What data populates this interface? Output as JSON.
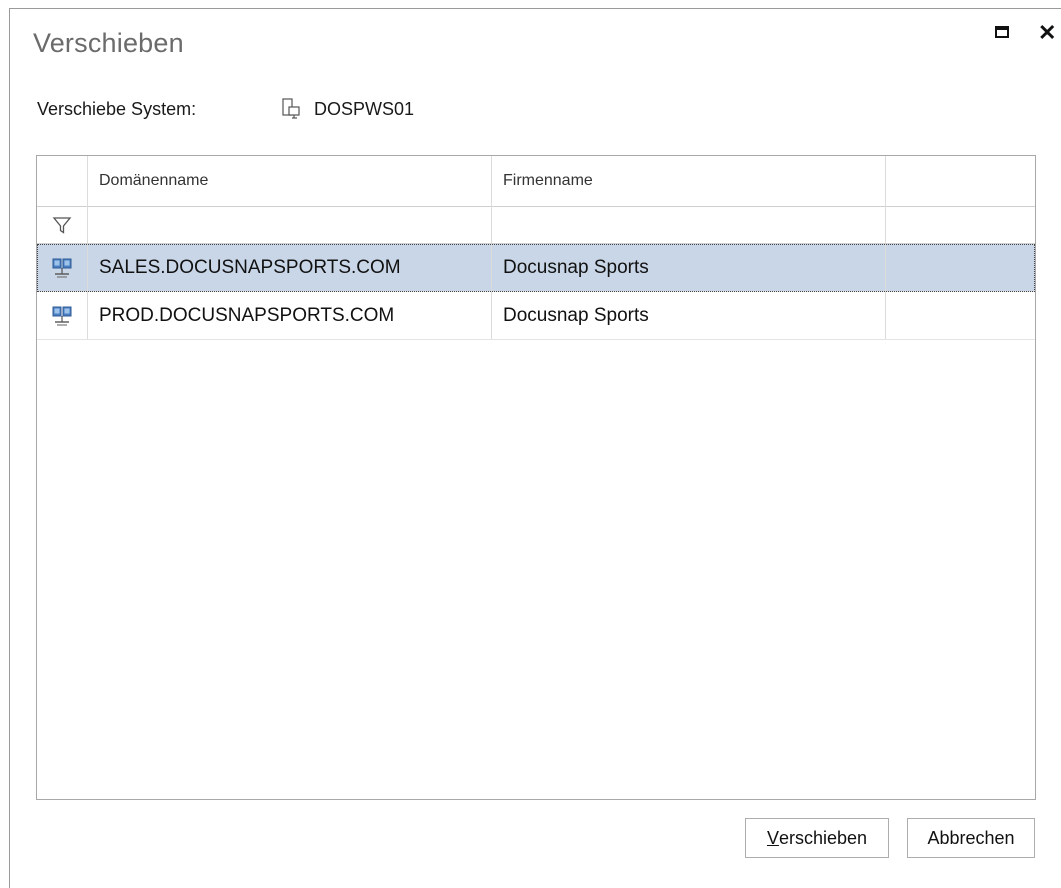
{
  "dialog": {
    "title": "Verschieben",
    "maximize_icon": "maximize-icon",
    "close_icon": "close-icon",
    "close_glyph": "✕"
  },
  "system": {
    "label": "Verschiebe System:",
    "icon": "computer-icon",
    "name": "DOSPWS01"
  },
  "grid": {
    "columns": [
      "Domänenname",
      "Firmenname"
    ],
    "filter_icon": "filter-icon",
    "rows": [
      {
        "icon": "domain-icon",
        "domain": "SALES.DOCUSNAPSPORTS.COM",
        "company": "Docusnap Sports",
        "selected": true
      },
      {
        "icon": "domain-icon",
        "domain": "PROD.DOCUSNAPSPORTS.COM",
        "company": "Docusnap Sports",
        "selected": false
      }
    ],
    "selection_color": "#c9d6e8"
  },
  "buttons": {
    "move_mnemonic": "V",
    "move_rest": "erschieben",
    "cancel": "Abbrechen"
  }
}
